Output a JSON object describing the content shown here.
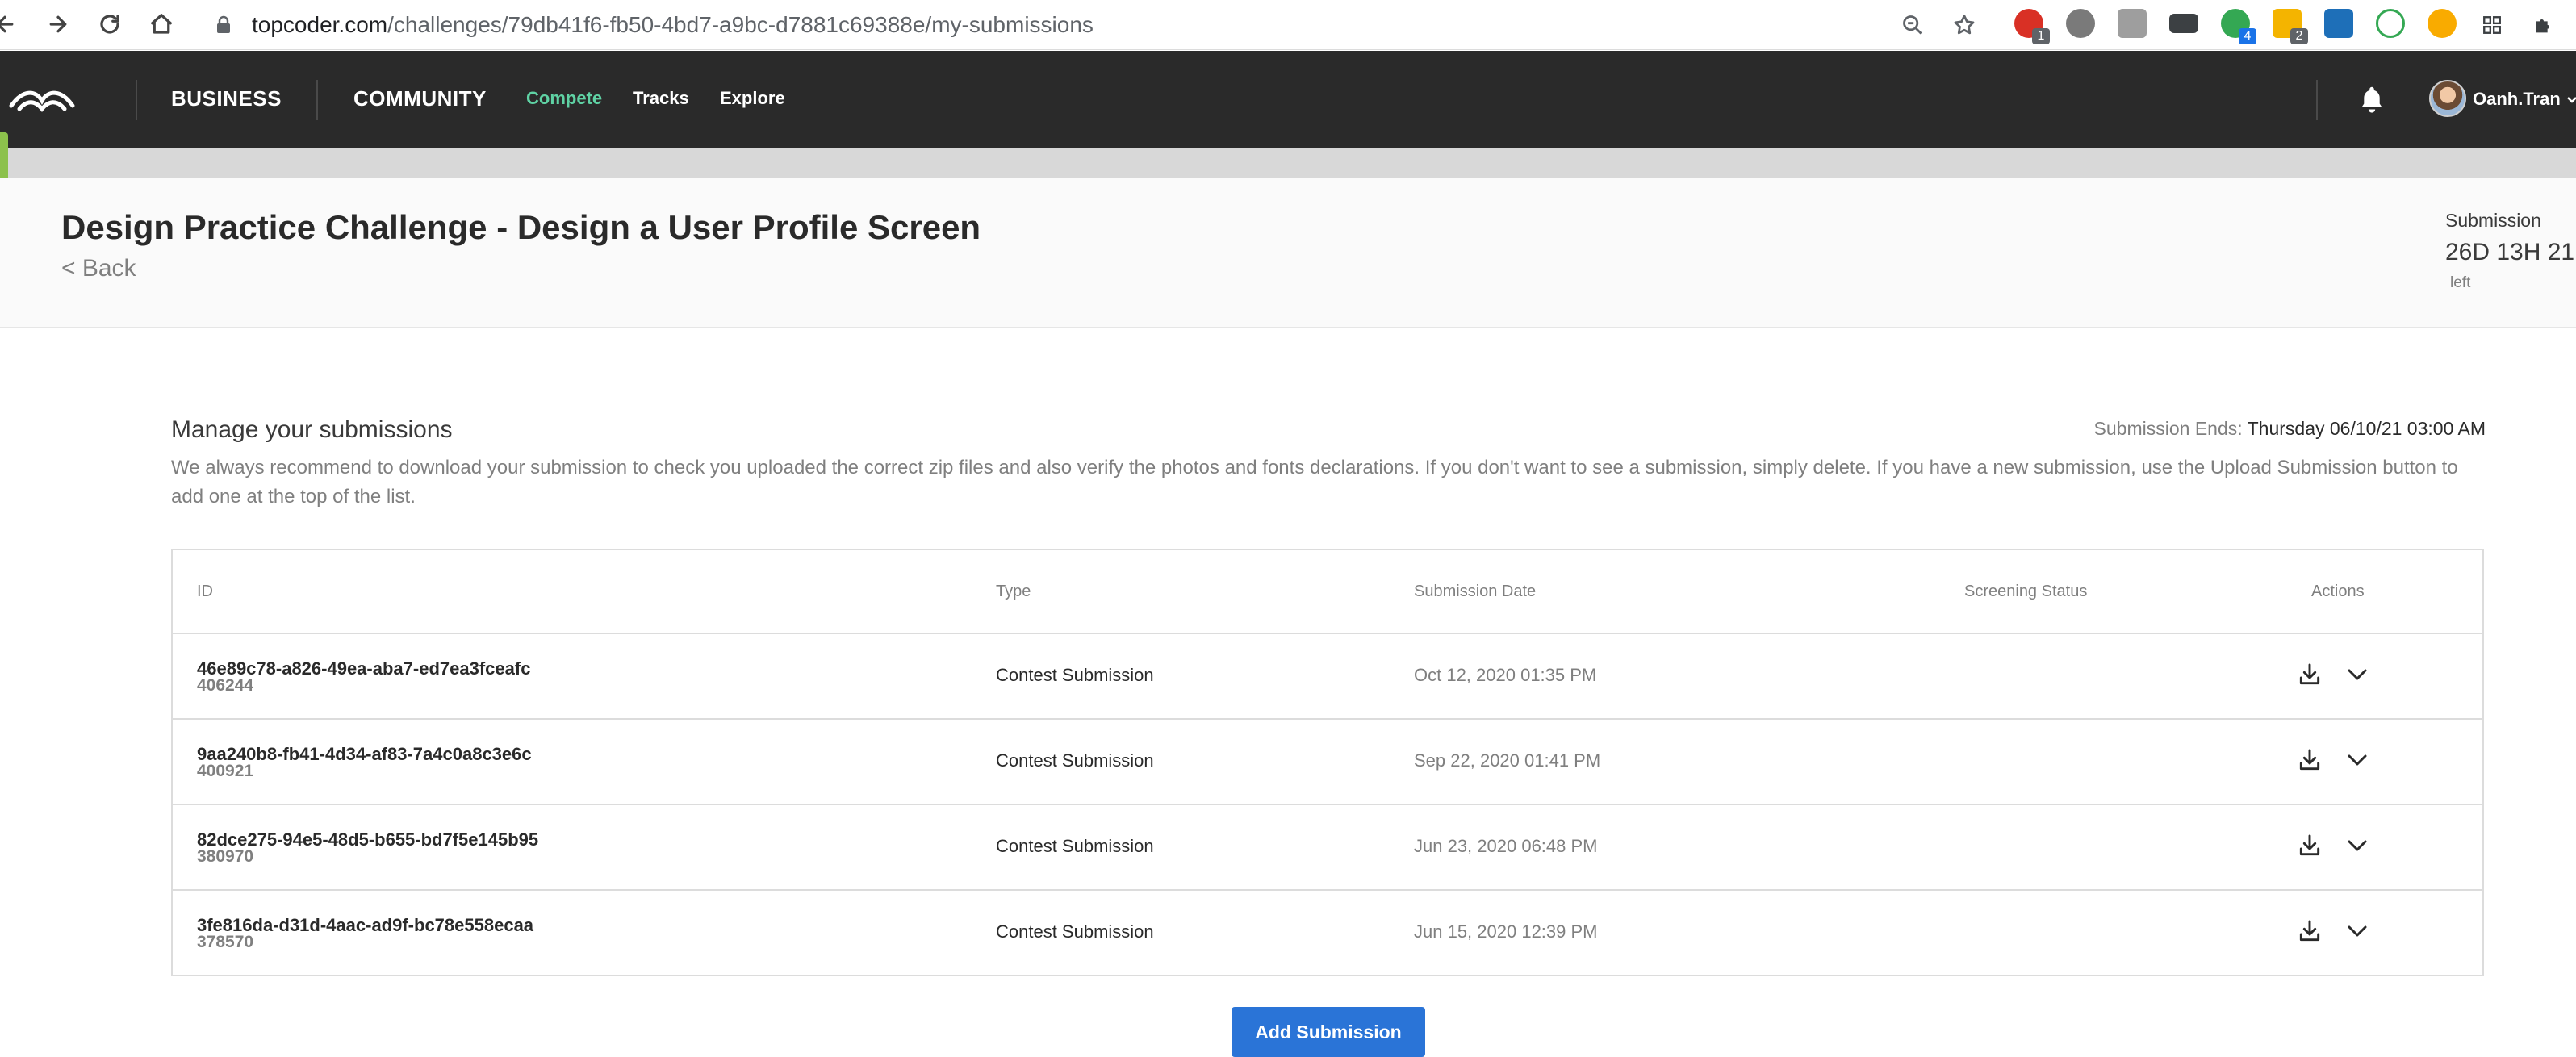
{
  "browser": {
    "url_host": "topcoder.com",
    "url_path": "/challenges/79db41f6-fb50-4bd7-a9bc-d7881c69388e/my-submissions",
    "extension_badges": [
      "1",
      "4",
      "2"
    ]
  },
  "header": {
    "main_nav": [
      "BUSINESS",
      "COMMUNITY"
    ],
    "sub_nav": [
      {
        "label": "Compete",
        "active": true
      },
      {
        "label": "Tracks",
        "active": false
      },
      {
        "label": "Explore",
        "active": false
      }
    ],
    "username": "Oanh.Tran"
  },
  "challenge": {
    "title": "Design Practice Challenge - Design a User Profile Screen",
    "back_label": "< Back",
    "submission_label": "Submission",
    "submission_timer": "26D 13H 21",
    "submission_left": "left"
  },
  "manage": {
    "title": "Manage your submissions",
    "ends_label": "Submission Ends:",
    "ends_value": "Thursday 06/10/21 03:00 AM",
    "description": "We always recommend to download your submission to check you uploaded the correct zip files and also verify the photos and fonts declarations. If you don't want to see a submission, simply delete. If you have a new submission, use the Upload Submission button to add one at the top of the list."
  },
  "table": {
    "headers": [
      "ID",
      "Type",
      "Submission Date",
      "Screening Status",
      "Actions"
    ],
    "rows": [
      {
        "id": "46e89c78-a826-49ea-aba7-ed7ea3fceafc",
        "num": "406244",
        "type": "Contest Submission",
        "date": "Oct 12, 2020 01:35 PM",
        "status": ""
      },
      {
        "id": "9aa240b8-fb41-4d34-af83-7a4c0a8c3e6c",
        "num": "400921",
        "type": "Contest Submission",
        "date": "Sep 22, 2020 01:41 PM",
        "status": ""
      },
      {
        "id": "82dce275-94e5-48d5-b655-bd7f5e145b95",
        "num": "380970",
        "type": "Contest Submission",
        "date": "Jun 23, 2020 06:48 PM",
        "status": ""
      },
      {
        "id": "3fe816da-d31d-4aac-ad9f-bc78e558ecaa",
        "num": "378570",
        "type": "Contest Submission",
        "date": "Jun 15, 2020 12:39 PM",
        "status": ""
      }
    ]
  },
  "add_submission_label": "Add Submission",
  "colors": {
    "header_bg": "#2a2a2a",
    "active_nav": "#5fd2a4",
    "button_blue": "#2a74d7",
    "side_tab": "#8cc14c"
  }
}
